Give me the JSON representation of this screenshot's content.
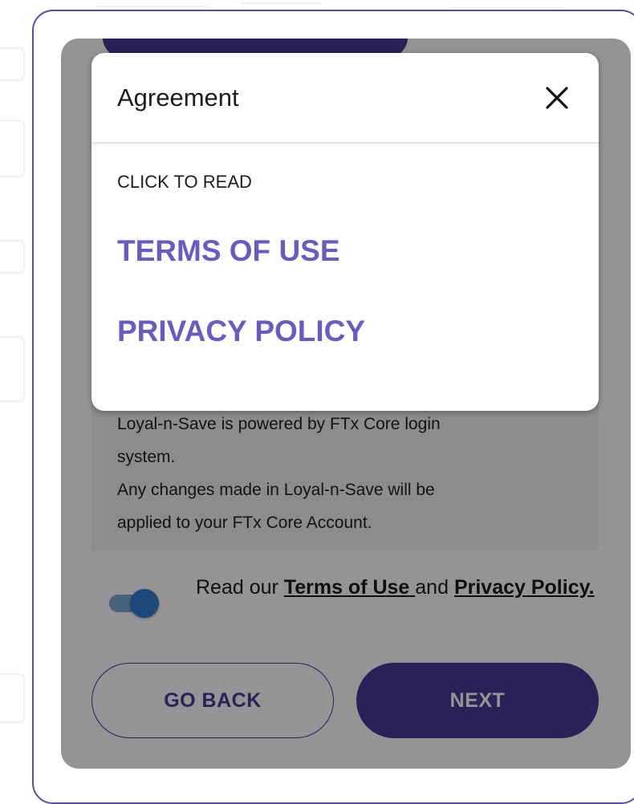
{
  "dialog": {
    "title": "Agreement",
    "close_icon": "close-icon",
    "subtitle": "CLICK TO READ",
    "terms_link": "TERMS OF USE",
    "privacy_link": "PRIVACY POLICY"
  },
  "info": {
    "line1": "Loyal-n-Save is powered by FTx Core login",
    "line2": "system.",
    "line3": "Any changes made in Loyal-n-Save will be",
    "line4": "applied to your FTx Core Account."
  },
  "consent": {
    "prefix": "Read our ",
    "terms": "Terms of Use ",
    "middle": "and ",
    "privacy": "Privacy Policy.",
    "toggle_on": true
  },
  "buttons": {
    "back": "GO BACK",
    "next": "NEXT"
  },
  "colors": {
    "brand": "#4a3a98",
    "link": "#6a5bc4",
    "toggle": "#2f7fd2"
  }
}
